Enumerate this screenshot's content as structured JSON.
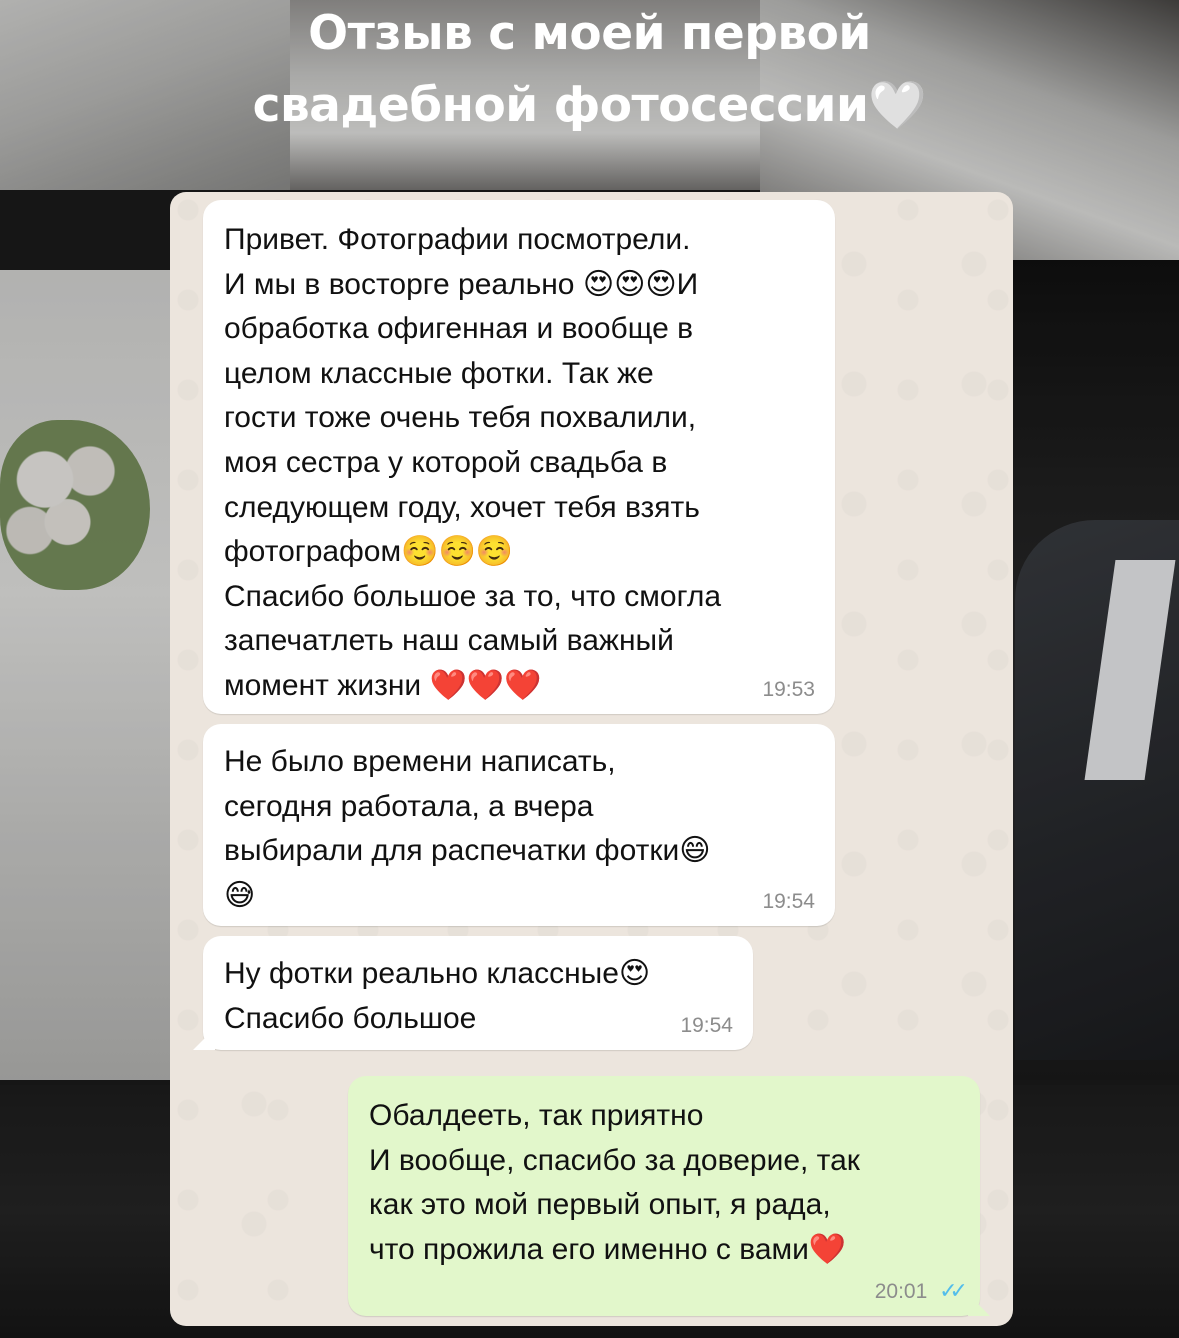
{
  "title": {
    "line1": "Отзыв с моей первой",
    "line2": "свадебной фотосессии🤍"
  },
  "messages": [
    {
      "direction": "incoming",
      "text": "Привет.  Фотографии посмотрели.\nИ мы в восторге реально 😍😍😍И\nобработка офигенная и вообще в\nцелом классные фотки. Так же\nгости тоже очень тебя похвалили,\nмоя сестра у которой свадьба в\nследующем году,  хочет тебя взять\nфотографом☺️☺️☺️\nСпасибо большое за то, что смогла\nзапечатлеть наш самый важный\nмомент жизни ❤️❤️❤️",
      "time": "19:53"
    },
    {
      "direction": "incoming",
      "text": "Не было времени написать,\nсегодня работала, а вчера\nвыбирали для распечатки фотки😄\n😅",
      "time": "19:54"
    },
    {
      "direction": "incoming",
      "text": "Ну фотки реально классные😍\nСпасибо большое",
      "time": "19:54"
    },
    {
      "direction": "outgoing",
      "text": "Обалдееть, так приятно\nИ вообще, спасибо за доверие, так\nкак это мой первый опыт, я рада,\nчто прожила его именно с вами❤️",
      "time": "20:01",
      "status": "read"
    }
  ],
  "colors": {
    "incoming_bubble": "#ffffff",
    "outgoing_bubble": "#e2f7cb",
    "chat_background": "#ece5dd",
    "read_ticks": "#53bdeb"
  },
  "icons": {
    "read_status": "double-check-icon"
  }
}
